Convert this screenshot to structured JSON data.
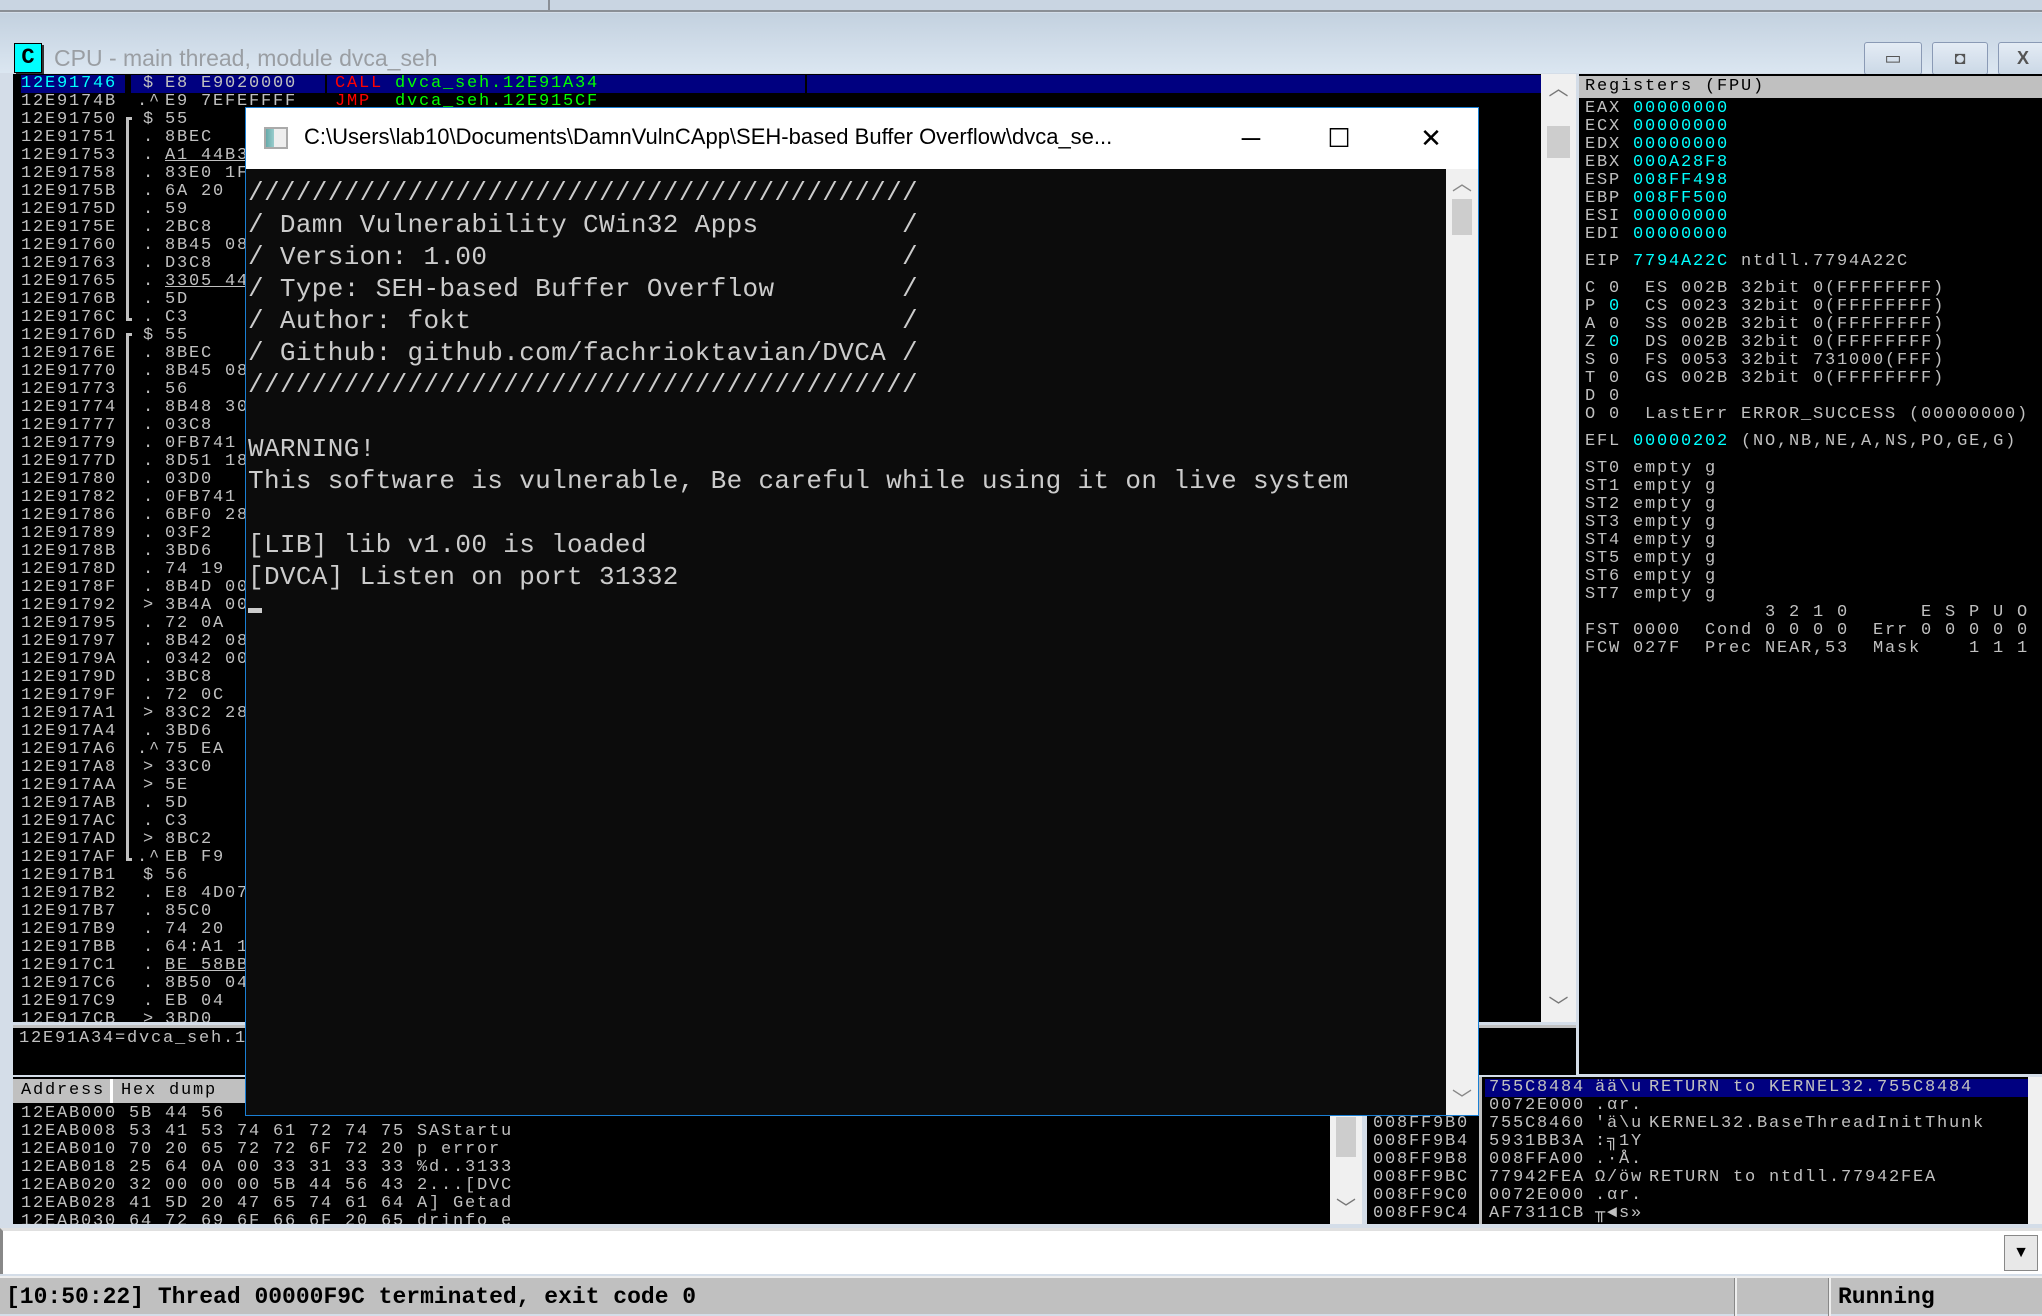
{
  "window": {
    "title": "CPU - main thread, module dvca_seh",
    "icon_letter": "C",
    "minimize": "▭",
    "restore": "◘",
    "close": "X"
  },
  "colors": {
    "address_cyan": "#00ffff",
    "selection": "#000080",
    "call_red": "#ff0000",
    "target_green": "#00ff00",
    "text_gray": "#c0c0c0"
  },
  "disasm": {
    "rows": [
      {
        "addr": "12E91746",
        "m": "$",
        "hex": "E8 E9020000",
        "op": "CALL",
        "arg": "dvca_seh.12E91A34",
        "sel": true
      },
      {
        "addr": "12E9174B",
        "m": ".^",
        "hex": "E9 7EFEFFFF",
        "op": "JMP",
        "arg": "dvca_seh.12E915CF"
      },
      {
        "addr": "12E91750",
        "m": "$",
        "hex": "55",
        "b": "start"
      },
      {
        "addr": "12E91751",
        "m": ".",
        "hex": "8BEC",
        "b": "mid"
      },
      {
        "addr": "12E91753",
        "m": ".",
        "hex": "A1 44B3",
        "b": "mid",
        "u": true
      },
      {
        "addr": "12E91758",
        "m": ".",
        "hex": "83E0 1F",
        "b": "mid"
      },
      {
        "addr": "12E9175B",
        "m": ".",
        "hex": "6A 20",
        "b": "mid"
      },
      {
        "addr": "12E9175D",
        "m": ".",
        "hex": "59",
        "b": "mid"
      },
      {
        "addr": "12E9175E",
        "m": ".",
        "hex": "2BC8",
        "b": "mid"
      },
      {
        "addr": "12E91760",
        "m": ".",
        "hex": "8B45 08",
        "b": "mid"
      },
      {
        "addr": "12E91763",
        "m": ".",
        "hex": "D3C8",
        "b": "mid"
      },
      {
        "addr": "12E91765",
        "m": ".",
        "hex": "3305 44",
        "b": "mid",
        "u": true
      },
      {
        "addr": "12E9176B",
        "m": ".",
        "hex": "5D",
        "b": "mid"
      },
      {
        "addr": "12E9176C",
        "m": ".",
        "hex": "C3",
        "b": "end"
      },
      {
        "addr": "12E9176D",
        "m": "$",
        "hex": "55",
        "b": "start"
      },
      {
        "addr": "12E9176E",
        "m": ".",
        "hex": "8BEC",
        "b": "mid"
      },
      {
        "addr": "12E91770",
        "m": ".",
        "hex": "8B45 08",
        "b": "mid"
      },
      {
        "addr": "12E91773",
        "m": ".",
        "hex": "56",
        "b": "mid"
      },
      {
        "addr": "12E91774",
        "m": ".",
        "hex": "8B48 30",
        "b": "mid"
      },
      {
        "addr": "12E91777",
        "m": ".",
        "hex": "03C8",
        "b": "mid"
      },
      {
        "addr": "12E91779",
        "m": ".",
        "hex": "0FB741",
        "b": "mid"
      },
      {
        "addr": "12E9177D",
        "m": ".",
        "hex": "8D51 18",
        "b": "mid"
      },
      {
        "addr": "12E91780",
        "m": ".",
        "hex": "03D0",
        "b": "mid"
      },
      {
        "addr": "12E91782",
        "m": ".",
        "hex": "0FB741",
        "b": "mid"
      },
      {
        "addr": "12E91786",
        "m": ".",
        "hex": "6BF0 28",
        "b": "mid"
      },
      {
        "addr": "12E91789",
        "m": ".",
        "hex": "03F2",
        "b": "mid"
      },
      {
        "addr": "12E9178B",
        "m": ".",
        "hex": "3BD6",
        "b": "mid"
      },
      {
        "addr": "12E9178D",
        "m": ".",
        "hex": "74 19",
        "b": "mid"
      },
      {
        "addr": "12E9178F",
        "m": ".",
        "hex": "8B4D 00",
        "b": "mid"
      },
      {
        "addr": "12E91792",
        "m": ">",
        "hex": "3B4A 00",
        "b": "mid"
      },
      {
        "addr": "12E91795",
        "m": ".",
        "hex": "72 0A",
        "b": "mid"
      },
      {
        "addr": "12E91797",
        "m": ".",
        "hex": "8B42 08",
        "b": "mid"
      },
      {
        "addr": "12E9179A",
        "m": ".",
        "hex": "0342 00",
        "b": "mid"
      },
      {
        "addr": "12E9179D",
        "m": ".",
        "hex": "3BC8",
        "b": "mid"
      },
      {
        "addr": "12E9179F",
        "m": ".",
        "hex": "72 0C",
        "b": "mid"
      },
      {
        "addr": "12E917A1",
        "m": ">",
        "hex": "83C2 28",
        "b": "mid"
      },
      {
        "addr": "12E917A4",
        "m": ".",
        "hex": "3BD6",
        "b": "mid"
      },
      {
        "addr": "12E917A6",
        "m": ".^",
        "hex": "75 EA",
        "b": "mid"
      },
      {
        "addr": "12E917A8",
        "m": ">",
        "hex": "33C0",
        "b": "mid"
      },
      {
        "addr": "12E917AA",
        "m": ">",
        "hex": "5E",
        "b": "mid"
      },
      {
        "addr": "12E917AB",
        "m": ".",
        "hex": "5D",
        "b": "mid"
      },
      {
        "addr": "12E917AC",
        "m": ".",
        "hex": "C3",
        "b": "mid"
      },
      {
        "addr": "12E917AD",
        "m": ">",
        "hex": "8BC2",
        "b": "mid"
      },
      {
        "addr": "12E917AF",
        "m": ".^",
        "hex": "EB F9",
        "b": "end"
      },
      {
        "addr": "12E917B1",
        "m": "$",
        "hex": "56"
      },
      {
        "addr": "12E917B2",
        "m": ".",
        "hex": "E8 4D07"
      },
      {
        "addr": "12E917B7",
        "m": ".",
        "hex": "85C0"
      },
      {
        "addr": "12E917B9",
        "m": ".",
        "hex": "74 20"
      },
      {
        "addr": "12E917BB",
        "m": ".",
        "hex": "64:A1 1"
      },
      {
        "addr": "12E917C1",
        "m": ".",
        "hex": "BE 58BB",
        "u": true
      },
      {
        "addr": "12E917C6",
        "m": ".",
        "hex": "8B50 04"
      },
      {
        "addr": "12E917C9",
        "m": ".",
        "hex": "EB 04"
      },
      {
        "addr": "12E917CB",
        "m": ">",
        "hex": "3BD0"
      }
    ]
  },
  "info_line": "12E91A34=dvca_seh.1",
  "registers": {
    "header": "Registers (FPU)",
    "lines": [
      [
        {
          "t": "EAX "
        },
        {
          "t": "00000000",
          "hl": true
        }
      ],
      [
        {
          "t": "ECX "
        },
        {
          "t": "00000000",
          "hl": true
        }
      ],
      [
        {
          "t": "EDX "
        },
        {
          "t": "00000000",
          "hl": true
        }
      ],
      [
        {
          "t": "EBX "
        },
        {
          "t": "000A28F8",
          "hl": true
        }
      ],
      [
        {
          "t": "ESP "
        },
        {
          "t": "008FF498",
          "hl": true
        }
      ],
      [
        {
          "t": "EBP "
        },
        {
          "t": "008FF500",
          "hl": true
        }
      ],
      [
        {
          "t": "ESI "
        },
        {
          "t": "00000000",
          "hl": true
        }
      ],
      [
        {
          "t": "EDI "
        },
        {
          "t": "00000000",
          "hl": true
        }
      ],
      [],
      [
        {
          "t": "EIP "
        },
        {
          "t": "7794A22C",
          "hl": true
        },
        {
          "t": " ntdll.7794A22C"
        }
      ],
      [],
      [
        {
          "t": "C 0  ES 002B 32bit 0(FFFFFFFF)"
        }
      ],
      [
        {
          "t": "P "
        },
        {
          "t": "0",
          "hl": true
        },
        {
          "t": "  CS 0023 32bit 0(FFFFFFFF)"
        }
      ],
      [
        {
          "t": "A 0  SS 002B 32bit 0(FFFFFFFF)"
        }
      ],
      [
        {
          "t": "Z "
        },
        {
          "t": "0",
          "hl": true
        },
        {
          "t": "  DS 002B 32bit 0(FFFFFFFF)"
        }
      ],
      [
        {
          "t": "S 0  FS 0053 32bit 731000(FFF)"
        }
      ],
      [
        {
          "t": "T 0  GS 002B 32bit 0(FFFFFFFF)"
        }
      ],
      [
        {
          "t": "D 0"
        }
      ],
      [
        {
          "t": "O 0  LastErr ERROR_SUCCESS (00000000)"
        }
      ],
      [],
      [
        {
          "t": "EFL "
        },
        {
          "t": "00000202",
          "hl": true
        },
        {
          "t": " (NO,NB,NE,A,NS,PO,GE,G)"
        }
      ],
      [],
      [
        {
          "t": "ST0 empty g"
        }
      ],
      [
        {
          "t": "ST1 empty g"
        }
      ],
      [
        {
          "t": "ST2 empty g"
        }
      ],
      [
        {
          "t": "ST3 empty g"
        }
      ],
      [
        {
          "t": "ST4 empty g"
        }
      ],
      [
        {
          "t": "ST5 empty g"
        }
      ],
      [
        {
          "t": "ST6 empty g"
        }
      ],
      [
        {
          "t": "ST7 empty g"
        }
      ],
      [
        {
          "t": "               3 2 1 0      E S P U O"
        }
      ],
      [
        {
          "t": "FST 0000  Cond 0 0 0 0  Err 0 0 0 0 0"
        }
      ],
      [
        {
          "t": "FCW 027F  Prec NEAR,53  Mask    1 1 1"
        }
      ]
    ]
  },
  "dump": {
    "headers": [
      "Address",
      "Hex dump"
    ],
    "rows": [
      {
        "addr": "12EAB000",
        "hex": "5B 44 56",
        "ascii": ""
      },
      {
        "addr": "12EAB008",
        "hex": "53 41 53 74 61 72 74 75",
        "ascii": "SAStartu"
      },
      {
        "addr": "12EAB010",
        "hex": "70 20 65 72 72 6F 72 20",
        "ascii": "p error "
      },
      {
        "addr": "12EAB018",
        "hex": "25 64 0A 00 33 31 33 33",
        "ascii": "%d..3133"
      },
      {
        "addr": "12EAB020",
        "hex": "32 00 00 00 5B 44 56 43",
        "ascii": "2...[DVC"
      },
      {
        "addr": "12EAB028",
        "hex": "41 5D 20 47 65 74 61 64",
        "ascii": "A] Getad"
      },
      {
        "addr": "12EAB030",
        "hex": "64 72 69 6F 66 6F 20 65",
        "ascii": "drinfo e"
      }
    ]
  },
  "stack": {
    "rows": [
      {
        "addr": "",
        "val": "755C8484",
        "ascii": "ää\\u",
        "comment": "RETURN to KERNEL32.755C8484",
        "sel": true
      },
      {
        "addr": "",
        "val": "0072E000",
        "ascii": ".αr.",
        "comment": ""
      },
      {
        "addr": "008FF9B0",
        "val": "755C8460",
        "ascii": "'ä\\u",
        "comment": "KERNEL32.BaseThreadInitThunk"
      },
      {
        "addr": "008FF9B4",
        "val": "5931BB3A",
        "ascii": ":╗1Y",
        "comment": ""
      },
      {
        "addr": "008FF9B8",
        "val": "008FFA00",
        "ascii": ".·Å.",
        "comment": ""
      },
      {
        "addr": "008FF9BC",
        "val": "77942FEA",
        "ascii": "Ω/öw",
        "comment": "RETURN to ntdll.77942FEA"
      },
      {
        "addr": "008FF9C0",
        "val": "0072E000",
        "ascii": ".αr.",
        "comment": ""
      },
      {
        "addr": "008FF9C4",
        "val": "AF7311CB",
        "ascii": "╥◄s»",
        "comment": ""
      }
    ]
  },
  "command": {
    "value": "",
    "dropdown_icon": "▼"
  },
  "status": {
    "message": "[10:50:22] Thread 00000F9C terminated, exit code 0",
    "state": "Running"
  },
  "console": {
    "title": "C:\\Users\\lab10\\Documents\\DamnVulnCApp\\SEH-based Buffer Overflow\\dvca_se...",
    "minimize": "─",
    "maximize": "☐",
    "close": "✕",
    "lines": [
      "//////////////////////////////////////////",
      "/ Damn Vulnerability CWin32 Apps         /",
      "/ Version: 1.00                          /",
      "/ Type: SEH-based Buffer Overflow        /",
      "/ Author: fokt                           /",
      "/ Github: github.com/fachrioktavian/DVCA /",
      "//////////////////////////////////////////",
      "",
      "WARNING!",
      "This software is vulnerable, Be careful while using it on live system",
      "",
      "[LIB] lib v1.00 is loaded",
      "[DVCA] Listen on port 31332"
    ]
  }
}
